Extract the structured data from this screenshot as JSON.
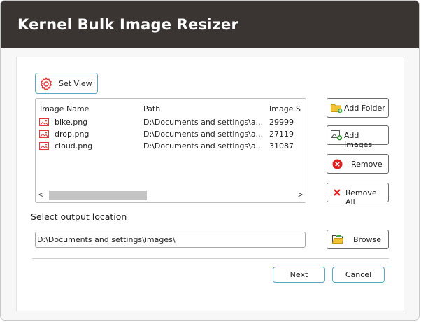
{
  "window": {
    "title": "Kernel Bulk Image Resizer"
  },
  "toolbar": {
    "set_view_label": "Set View",
    "set_view_icon": "gear-icon"
  },
  "list": {
    "columns": [
      "Image Name",
      "Path",
      "Image S"
    ],
    "rows": [
      {
        "name": "bike.png",
        "path": "D:\\Documents and settings\\a...",
        "size": "29999"
      },
      {
        "name": "drop.png",
        "path": "D:\\Documents and settings\\a...",
        "size": "27119"
      },
      {
        "name": "cloud.png",
        "path": "D:\\Documents and settings\\a...",
        "size": "31087"
      }
    ],
    "scroll_left": "<",
    "scroll_right": ">"
  },
  "actions": {
    "add_folder": "Add Folder",
    "add_images": "Add Images",
    "remove": "Remove",
    "remove_all": "Remove All"
  },
  "output": {
    "label": "Select output location",
    "path": "D:\\Documents and settings\\images\\",
    "browse": "Browse"
  },
  "footer": {
    "next": "Next",
    "cancel": "Cancel"
  },
  "colors": {
    "titlebar": "#3a3433",
    "accent_border": "#5aa7c7",
    "image_icon": "#e03a3a",
    "remove_icon": "#e02020",
    "folder_icon": "#f1c232"
  }
}
